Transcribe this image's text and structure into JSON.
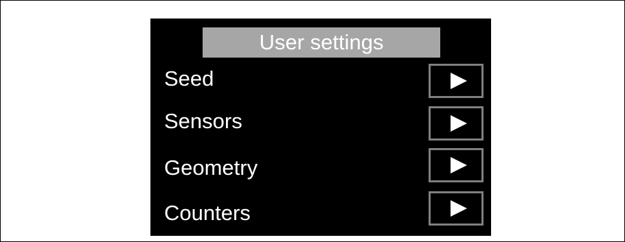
{
  "title": "User settings",
  "items": [
    {
      "label": "Seed",
      "action_icon": "play-right-arrow"
    },
    {
      "label": "Sensors",
      "action_icon": "play-right-arrow"
    },
    {
      "label": "Geometry",
      "action_icon": "play-right-arrow"
    },
    {
      "label": "Counters",
      "action_icon": "play-right-arrow"
    }
  ],
  "colors": {
    "screen_background": "#000000",
    "title_background": "#a6a6a6",
    "text": "#ffffff",
    "button_border": "#7f7f7f"
  }
}
